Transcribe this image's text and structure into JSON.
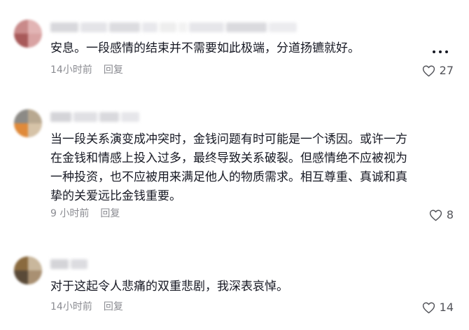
{
  "comments": [
    {
      "text": "安息。一段感情的结束并不需要如此极端，分道扬镳就好。",
      "time": "14小时前",
      "reply_label": "回复",
      "likes": "27"
    },
    {
      "text": "当一段关系演变成冲突时，金钱问题有时可能是一个诱因。或许一方在金钱和情感上投入过多，最终导致关系破裂。但感情绝不应被视为一种投资，也不应被用来满足他人的物质需求。相互尊重、真诚和真挚的关爱远比金钱重要。",
      "time": "9 小时前",
      "reply_label": "回复",
      "likes": "8"
    },
    {
      "text": "对于这起令人悲痛的双重悲剧，我深表哀悼。",
      "time": "14小时前",
      "reply_label": "回复",
      "likes": "14"
    }
  ],
  "icons": {
    "like": "heart-outline-icon",
    "more": "more-horizontal-icon"
  },
  "colors": {
    "text": "#161823",
    "meta": "#8a8b91",
    "likes": "#53545a"
  }
}
